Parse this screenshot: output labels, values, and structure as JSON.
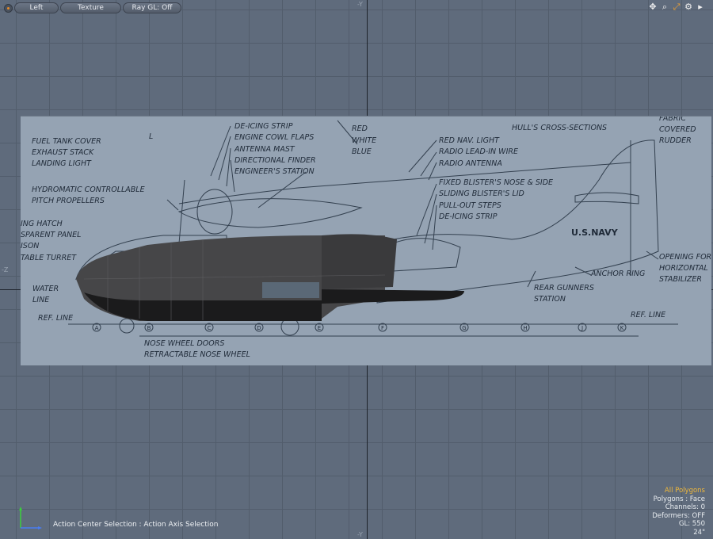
{
  "toolbar": {
    "view_button": "Left",
    "shading_button": "Texture",
    "raygl_button": "Ray GL: Off",
    "icons": [
      "move-view-icon",
      "zoom-icon",
      "maximize-icon",
      "gear-icon",
      "expand-arrow-icon"
    ]
  },
  "axis": {
    "top_label": "-Y",
    "bottom_label": "-Y",
    "left_label": "-Z"
  },
  "blueprint_labels": {
    "deicing_strip_top": "DE-ICING STRIP",
    "engine_cowl_flaps": "ENGINE COWL FLAPS",
    "antenna_mast": "ANTENNA MAST",
    "directional_finder": "DIRECTIONAL FINDER",
    "engineers_station": "ENGINEER'S STATION",
    "red": "RED",
    "white": "WHITE",
    "blue": "BLUE",
    "red_nav_light": "RED NAV. LIGHT",
    "radio_lead_in_wire": "RADIO LEAD-IN WIRE",
    "radio_antenna": "RADIO ANTENNA",
    "hulls_cross_sections": "HULL'S CROSS-SECTIONS",
    "fabric": "FABRIC",
    "covered": "COVERED",
    "rudder": "RUDDER",
    "fuel_tank_cover": "FUEL TANK COVER",
    "exhaust_stack": "EXHAUST STACK",
    "landing_light": "LANDING LIGHT",
    "l_marker": "L",
    "hydromatic": "HYDROMATIC CONTROLLABLE",
    "pitch_propellers": "PITCH PROPELLERS",
    "fixed_blisters": "FIXED BLISTER'S NOSE & SIDE",
    "sliding_blisters": "SLIDING BLISTER'S LID",
    "pull_out_steps": "PULL-OUT STEPS",
    "deicing_strip_mid": "DE-ICING STRIP",
    "us_navy": "U.S.NAVY",
    "ing_hatch": "ING HATCH",
    "sparent_panel": "SPARENT PANEL",
    "ison": "ISON",
    "table_turret": "TABLE TURRET",
    "opening_for": "OPENING FOR",
    "horizontal": "HORIZONTAL",
    "stabilizer": "STABILIZER",
    "anchor_ring": "ANCHOR RING",
    "water": "WATER",
    "line": "LINE",
    "rear_gunners": "REAR GUNNERS",
    "station": "STATION",
    "ref_line_left": "REF. LINE",
    "ref_line_right": "REF. LINE",
    "nose_wheel_doors": "NOSE WHEEL DOORS",
    "retractable_nose_wheel": "RETRACTABLE NOSE WHEEL",
    "stations": [
      "A",
      "B",
      "C",
      "D",
      "E",
      "F",
      "G",
      "H",
      "J",
      "K"
    ]
  },
  "status": {
    "action_center": "Action Center Selection : Action Axis Selection"
  },
  "info": {
    "selection_mode": "All Polygons",
    "polygons": "Polygons : Face",
    "channels": "Channels: 0",
    "deformers": "Deformers: OFF",
    "gl": "GL: 550",
    "size": "24\""
  },
  "colors": {
    "viewport_bg": "#5f6b7c",
    "highlight": "#f0b83a",
    "mesh_dark": "#3c3c3e"
  }
}
